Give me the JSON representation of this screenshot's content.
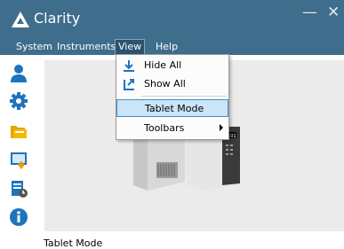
{
  "app": {
    "title": "Clarity"
  },
  "menubar": {
    "items": [
      {
        "label": "System"
      },
      {
        "label": "Instruments"
      },
      {
        "label": "View"
      },
      {
        "label": "Help"
      }
    ]
  },
  "view_menu": {
    "items": [
      {
        "label": "Hide All",
        "icon": "hide-all-icon"
      },
      {
        "label": "Show All",
        "icon": "show-all-icon"
      },
      {
        "label": "Tablet Mode",
        "highlighted": true
      },
      {
        "label": "Toolbars",
        "submenu": true
      }
    ]
  },
  "sidebar": {
    "icons": [
      "user-icon",
      "gear-icon",
      "folder-icon",
      "import-icon",
      "schedule-icon",
      "info-icon"
    ]
  },
  "status": {
    "text": "Tablet Mode"
  },
  "colors": {
    "titlebar": "#3f6d8c",
    "accent": "#1e73be",
    "highlight": "#cce4f7"
  }
}
